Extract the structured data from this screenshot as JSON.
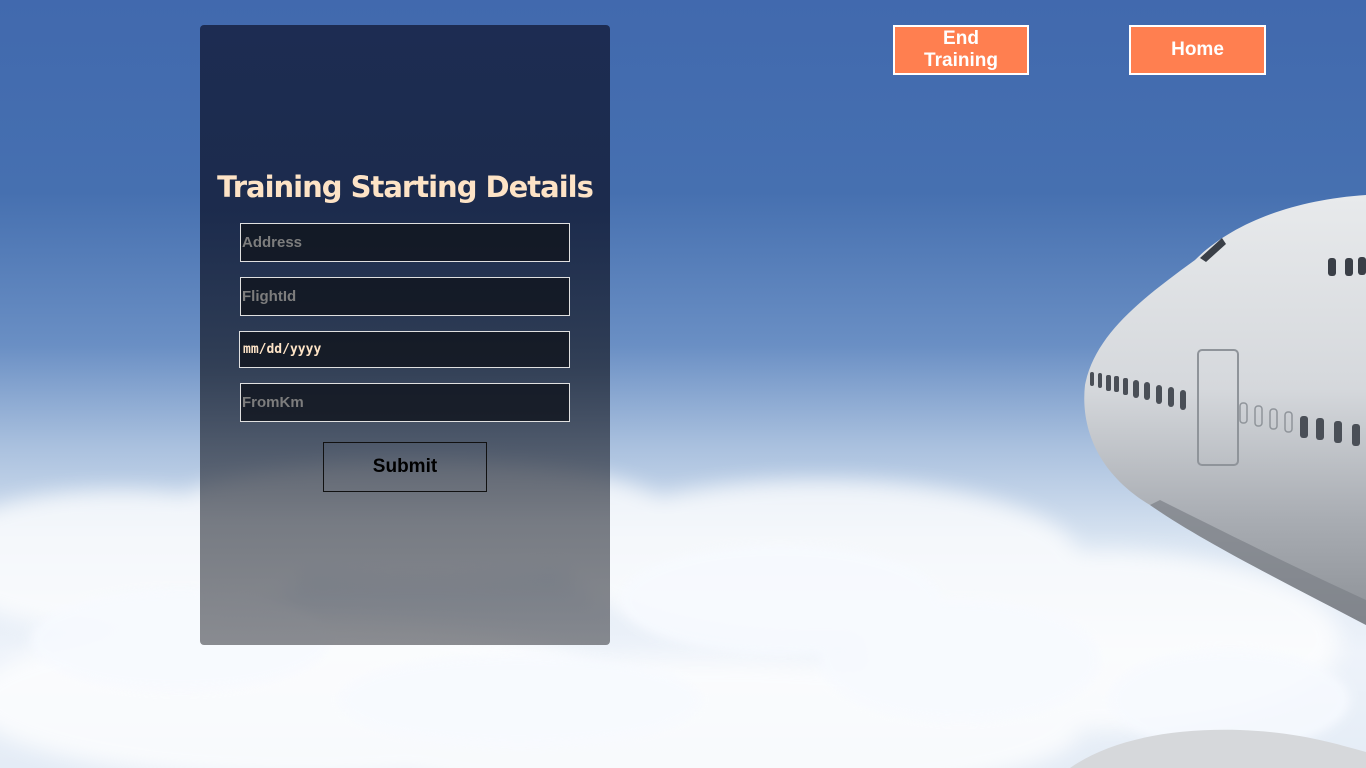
{
  "form": {
    "title": "Training Starting Details",
    "address_placeholder": "Address",
    "flightid_placeholder": "FlightId",
    "date_placeholder": "mm/dd/yyyy",
    "fromkm_placeholder": "FromKm",
    "submit_label": "Submit"
  },
  "nav": {
    "end_training_label": "End Training",
    "home_label": "Home"
  },
  "colors": {
    "accent": "#ff7f50",
    "title": "#fde3c6",
    "sky": "#4169ae"
  }
}
